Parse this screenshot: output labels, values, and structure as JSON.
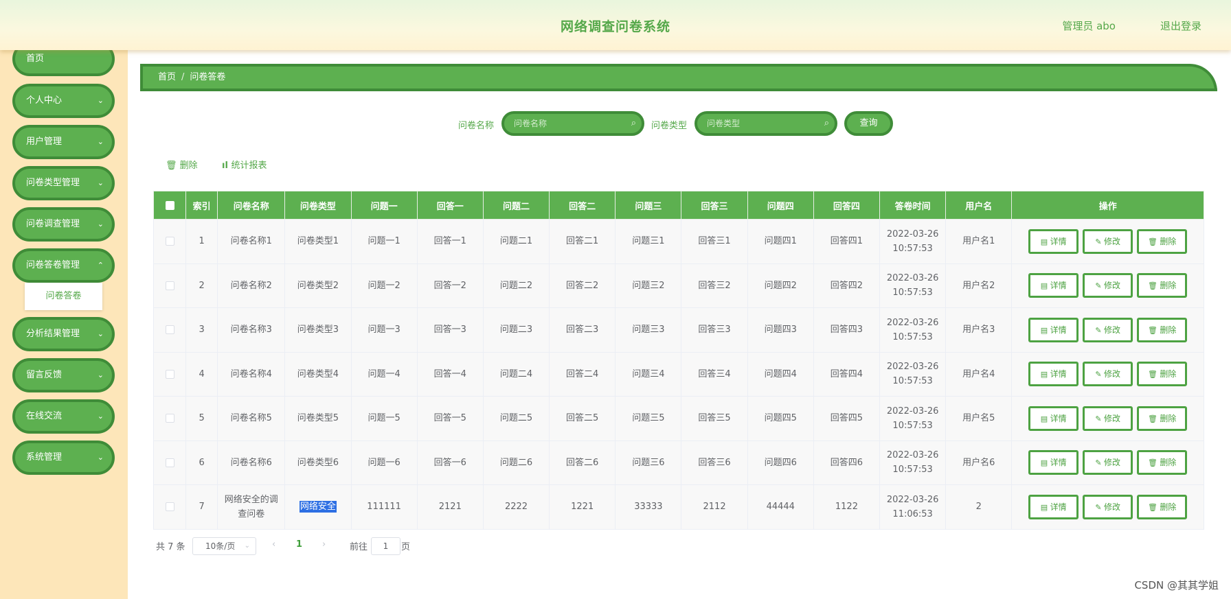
{
  "header": {
    "title": "网络调查问卷系统",
    "user": "管理员 abo",
    "logout": "退出登录"
  },
  "sidebar": {
    "items": [
      {
        "label": "首页",
        "arrow": ""
      },
      {
        "label": "个人中心",
        "arrow": "⌄"
      },
      {
        "label": "用户管理",
        "arrow": "⌄"
      },
      {
        "label": "问卷类型管理",
        "arrow": "⌄"
      },
      {
        "label": "问卷调查管理",
        "arrow": "⌄"
      },
      {
        "label": "问卷答卷管理",
        "arrow": "⌃"
      },
      {
        "label": "分析结果管理",
        "arrow": "⌄"
      },
      {
        "label": "留言反馈",
        "arrow": "⌄"
      },
      {
        "label": "在线交流",
        "arrow": "⌄"
      },
      {
        "label": "系统管理",
        "arrow": "⌄"
      }
    ],
    "submenu": "问卷答卷"
  },
  "breadcrumb": {
    "home": "首页",
    "sep": "/",
    "current": "问卷答卷"
  },
  "search": {
    "name_label": "问卷名称",
    "name_placeholder": "问卷名称",
    "type_label": "问卷类型",
    "type_placeholder": "问卷类型",
    "query": "查询"
  },
  "toolbar": {
    "delete": "删除",
    "report": "统计报表"
  },
  "table": {
    "headers": [
      "索引",
      "问卷名称",
      "问卷类型",
      "问题一",
      "回答一",
      "问题二",
      "回答二",
      "问题三",
      "回答三",
      "问题四",
      "回答四",
      "答卷时间",
      "用户名",
      "操作"
    ],
    "rows": [
      [
        "1",
        "问卷名称1",
        "问卷类型1",
        "问题一1",
        "回答一1",
        "问题二1",
        "回答二1",
        "问题三1",
        "回答三1",
        "问题四1",
        "回答四1",
        "2022-03-26 10:57:53",
        "用户名1"
      ],
      [
        "2",
        "问卷名称2",
        "问卷类型2",
        "问题一2",
        "回答一2",
        "问题二2",
        "回答二2",
        "问题三2",
        "回答三2",
        "问题四2",
        "回答四2",
        "2022-03-26 10:57:53",
        "用户名2"
      ],
      [
        "3",
        "问卷名称3",
        "问卷类型3",
        "问题一3",
        "回答一3",
        "问题二3",
        "回答二3",
        "问题三3",
        "回答三3",
        "问题四3",
        "回答四3",
        "2022-03-26 10:57:53",
        "用户名3"
      ],
      [
        "4",
        "问卷名称4",
        "问卷类型4",
        "问题一4",
        "回答一4",
        "问题二4",
        "回答二4",
        "问题三4",
        "回答三4",
        "问题四4",
        "回答四4",
        "2022-03-26 10:57:53",
        "用户名4"
      ],
      [
        "5",
        "问卷名称5",
        "问卷类型5",
        "问题一5",
        "回答一5",
        "问题二5",
        "回答二5",
        "问题三5",
        "回答三5",
        "问题四5",
        "回答四5",
        "2022-03-26 10:57:53",
        "用户名5"
      ],
      [
        "6",
        "问卷名称6",
        "问卷类型6",
        "问题一6",
        "回答一6",
        "问题二6",
        "回答二6",
        "问题三6",
        "回答三6",
        "问题四6",
        "回答四6",
        "2022-03-26 10:57:53",
        "用户名6"
      ],
      [
        "7",
        "网络安全的调查问卷",
        "网络安全",
        "111111",
        "2121",
        "2222",
        "1221",
        "33333",
        "2112",
        "44444",
        "1122",
        "2022-03-26 11:06:53",
        "2"
      ]
    ],
    "actions": {
      "detail": "详情",
      "edit": "修改",
      "delete": "删除"
    }
  },
  "pagination": {
    "total": "共 7 条",
    "size": "10条/页",
    "current": "1",
    "goto_prefix": "前往",
    "goto_value": "1",
    "goto_suffix": "页"
  },
  "watermark": "CSDN @其其学姐"
}
